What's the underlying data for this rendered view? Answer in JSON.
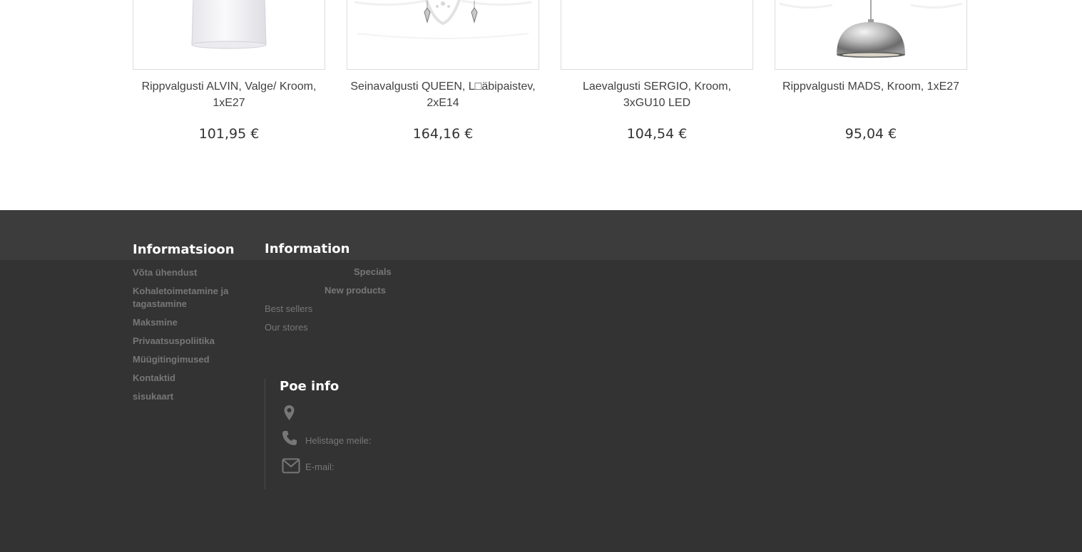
{
  "products": [
    {
      "name": "Rippvalgusti ALVIN, Valge/ Kroom, 1xE27",
      "price": "101,95 €"
    },
    {
      "name": "Seinavalgusti QUEEN, L□äbipaistev, 2xE14",
      "price": "164,16 €"
    },
    {
      "name": "Laevalgusti SERGIO, Kroom, 3xGU10 LED",
      "price": "104,54 €"
    },
    {
      "name": "Rippvalgusti MADS, Kroom, 1xE27",
      "price": "95,04 €"
    }
  ],
  "footer": {
    "informatsioon": {
      "heading": "Informatsioon",
      "links": [
        "Võta ühendust",
        "Kohaletoimetamine ja tagastamine",
        "Maksmine",
        "Privaatsuspoliitika",
        "Müügitingimused",
        "Kontaktid",
        "sisukaart"
      ]
    },
    "information": {
      "heading": "Information",
      "links": [
        "Specials",
        "New products",
        "Best sellers",
        "Our stores"
      ]
    },
    "store_info": {
      "heading": "Poe info",
      "phone_label": "Helistage meile:",
      "email_label": "E-mail:",
      "icons": [
        "map-marker-icon",
        "phone-icon",
        "envelope-icon"
      ]
    }
  },
  "colors": {
    "footer_top": "#3c3c3c",
    "footer_main": "#333333",
    "footer_link": "#777777",
    "heading": "#ffffff"
  }
}
